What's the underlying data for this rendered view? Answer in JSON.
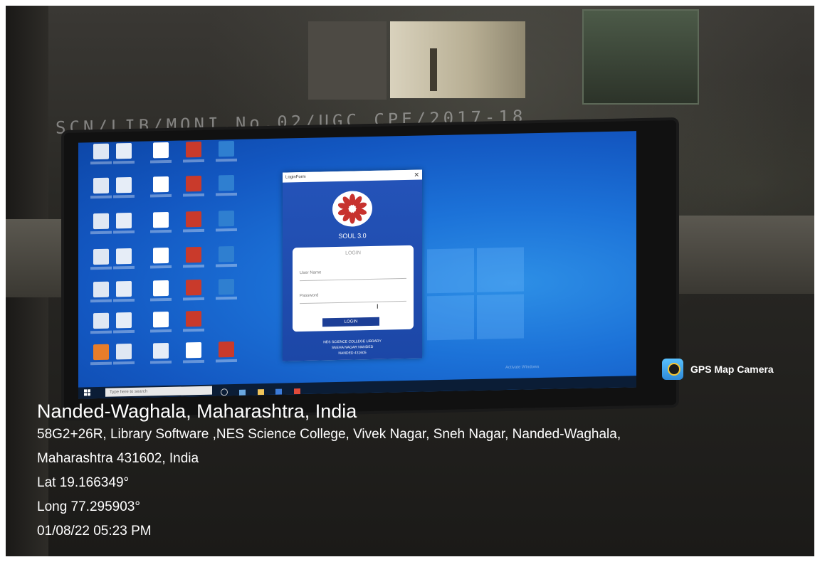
{
  "photo": {
    "label_strip": "SCN/LIB/MONI.No.02/UGC CPE/2017-18"
  },
  "login_window": {
    "title": "LoginForm",
    "app_name": "SOUL 3.0",
    "heading": "LOGIN",
    "username_placeholder": "User Name",
    "password_placeholder": "Password",
    "login_button": "LOGIN",
    "footer_line1": "NES SCIENCE COLLEGE LIBRARY",
    "footer_line2": "SNEHA NAGAR NANDED",
    "footer_line3": "NANDED 431605"
  },
  "taskbar": {
    "search_placeholder": "Type here to search"
  },
  "activate_windows": "Activate Windows",
  "gps": {
    "badge_label": "GPS Map Camera",
    "place": "Nanded-Waghala, Maharashtra, India",
    "address_line1": "58G2+26R, Library Software ,NES Science College, Vivek Nagar, Sneh Nagar, Nanded-Waghala,",
    "address_line2": "Maharashtra 431602, India",
    "lat": "Lat 19.166349°",
    "long": "Long 77.295903°",
    "datetime": "01/08/22 05:23 PM"
  },
  "colors": {
    "screen_blue": "#1c72d8",
    "login_blue": "#2453b8",
    "soul_red": "#c7322e"
  }
}
